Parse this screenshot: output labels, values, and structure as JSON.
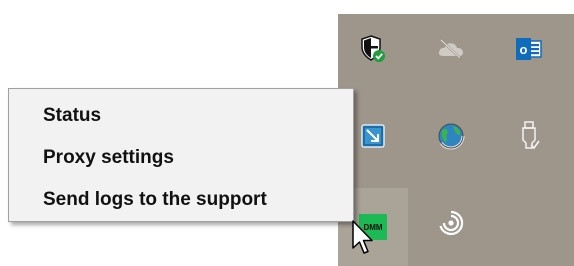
{
  "context_menu": {
    "items": [
      {
        "label": "Status"
      },
      {
        "label": "Proxy settings"
      },
      {
        "label": "Send logs to the support"
      }
    ]
  },
  "tray": {
    "background": "#9e968a",
    "icons": [
      {
        "name": "windows-security-icon"
      },
      {
        "name": "onedrive-offline-icon"
      },
      {
        "name": "outlook-icon",
        "text": "o"
      },
      {
        "name": "remote-desktop-icon"
      },
      {
        "name": "network-globe-icon"
      },
      {
        "name": "usb-safely-remove-icon"
      },
      {
        "name": "dmm-icon",
        "text": "DMM"
      },
      {
        "name": "swirl-app-icon"
      }
    ]
  },
  "colors": {
    "menu_background": "#f2f2f2",
    "menu_border": "#a0a0a0",
    "security_green": "#1e9e3e",
    "outlook_blue": "#0f6cbd",
    "dmm_green": "#1db954"
  }
}
